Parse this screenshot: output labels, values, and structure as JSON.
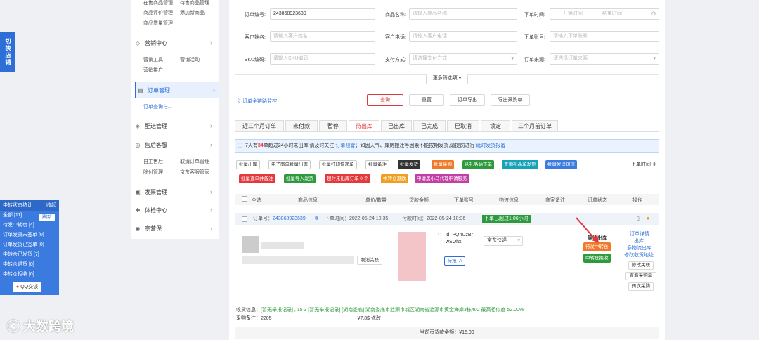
{
  "switch_store": "切换店铺",
  "stats": {
    "title": "中转状态统计",
    "collapse": "收起",
    "refresh": "刷新",
    "rows": [
      "全部 [11]",
      "待发中转仓 [4]",
      "订单发货未签单 [0]",
      "订单发货已签单 [0]",
      "中转仓已发货 [7]",
      "中转仓退货 [0]",
      "中转仓拒收 [0]"
    ],
    "qq": "QQ交谈"
  },
  "menu": {
    "top_items": [
      "在售商品管理",
      "待售商品管理",
      "商品评价管理",
      "添加新商品",
      "商品质量管理"
    ],
    "groups": [
      {
        "label": "营销中心",
        "icon": "tag-icon",
        "subs": [
          "营销工具",
          "营销活动",
          "营销推广"
        ]
      },
      {
        "label": "订单管理",
        "icon": "order-icon",
        "subs": [
          "订单查询与..."
        ]
      },
      {
        "label": "配送管理",
        "icon": "truck-icon",
        "subs": []
      },
      {
        "label": "售后客服",
        "icon": "headset-icon",
        "subs": [
          "自主售后",
          "取消订单管理",
          "除付管理",
          "京东客服管家"
        ]
      },
      {
        "label": "发票管理",
        "icon": "invoice-icon",
        "subs": []
      },
      {
        "label": "体检中心",
        "icon": "check-icon",
        "subs": []
      },
      {
        "label": "京营保",
        "icon": "shield-icon",
        "subs": []
      }
    ]
  },
  "filters": {
    "order_no_label": "订单编号:",
    "order_no_value": "243868923639",
    "product_name_label": "商品名称:",
    "product_name_ph": "请输入商品名称",
    "order_time_label": "下单时间:",
    "start_ph": "开始时间",
    "end_ph": "结束时间",
    "customer_name_label": "客户姓名:",
    "customer_name_ph": "请输入客户姓名",
    "customer_phone_label": "客户电话:",
    "customer_phone_ph": "请输入客户电话",
    "account_label": "下单账号:",
    "account_ph": "请输入下单账号",
    "sku_label": "SKU编码:",
    "sku_ph": "请输入SKU编码",
    "pay_label": "支付方式:",
    "pay_ph": "请选择支付方式",
    "source_label": "订单来源:",
    "source_ph": "请选择订单来源",
    "more": "更多筛选项 ▾"
  },
  "monitor_link": "订单全链路监控",
  "actions": {
    "query": "查询",
    "reset": "重置",
    "export": "订单导出",
    "export_purchase": "导出采购单"
  },
  "tabs": [
    "近三个月订单",
    "未付款",
    "暂停",
    "待出库",
    "已出库",
    "已完成",
    "已取消",
    "锁定",
    "三个月前订单"
  ],
  "active_tab": 3,
  "notice": {
    "pre": "7天有",
    "num": "34",
    "mid": "单超过24小时未出库,请及时关注",
    "link1": "订单预警",
    "mid2": "；如因天气、库房搬迁等因素不能按期发货,请提前进行",
    "link2": "延时发货报备"
  },
  "bulk_buttons_row1": [
    {
      "label": "批量出库",
      "color": "#ffffff"
    },
    {
      "label": "电子面单批量出库",
      "color": "#ffffff"
    },
    {
      "label": "批量打印快递单",
      "color": "#ffffff"
    },
    {
      "label": "批量备注",
      "color": "#ffffff"
    },
    {
      "label": "批量发货",
      "color": "#333333"
    },
    {
      "label": "批量采购",
      "color": "#f07a2a"
    },
    {
      "label": "从礼品站下单",
      "color": "#2e9a3d"
    },
    {
      "label": "查询礼品单发货",
      "color": "#17a2b8"
    },
    {
      "label": "批量发送短信",
      "color": "#3b7be0"
    }
  ],
  "bulk_buttons_row2": [
    {
      "label": "批量查单并备注",
      "color": "#e4393c"
    },
    {
      "label": "批量导入发货",
      "color": "#2e9a3d"
    },
    {
      "label": "超时未出库订单 0 个",
      "color": "#e4393c"
    },
    {
      "label": "中转仓退款",
      "color": "#f0a020"
    },
    {
      "label": "申请黑小马代理申请服务",
      "color": "#c23fa5"
    }
  ],
  "sort_label": "下单时间 ⇕",
  "table_headers": [
    "全选",
    "商品信息",
    "单价/数量",
    "货款金额",
    "下单账号",
    "物流信息",
    "商家备注",
    "订单状态",
    "操作"
  ],
  "order": {
    "order_no_label": "订单号：",
    "order_no": "243868923639",
    "order_time": "下单时间：2022-05-24 10:35",
    "pay_time": "付款时间：2022-05-24 10:36",
    "overdue_badge": "下单已超过1.06小时",
    "cancel_link": "取消关联",
    "account": "jd_PQnUzBrwSOhx",
    "verify_btn": "待报TA",
    "logistics": "京东快递",
    "status": "等待出库",
    "status_tag": "待发中转仓",
    "status_tag2": "中转仓拒收",
    "ops": [
      "订单详情",
      "出库",
      "多物流出库",
      "修改收货地址"
    ],
    "op_btns": [
      "修改关联",
      "查看采购单",
      "再次采购"
    ],
    "receiver_label": "收货信息：",
    "receiver_text": "[暂无举报记录] , 15          3 [暂无举报记录] [湖南娄底] 湖南娄底市涟源市城区湖南省涟源市黄金海岸3栋402 最高相似度 52.00%",
    "purchase_label": "采购备注：2205",
    "purchase_text": "¥7.8$ 修改"
  },
  "footer_total": "当前页货款金额：¥15.00",
  "watermark": "大数跨境"
}
